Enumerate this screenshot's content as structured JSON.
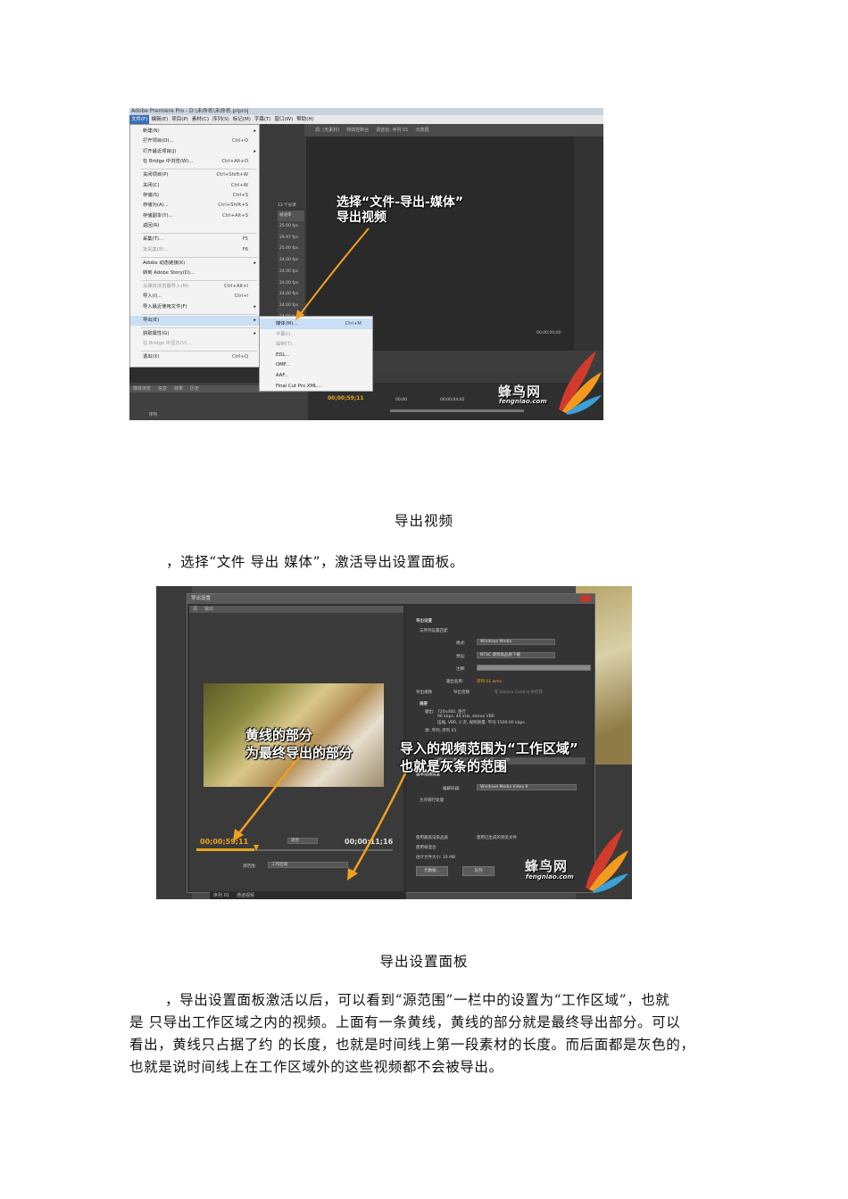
{
  "shot1": {
    "title_bar": "Adobe Premiere Pro - D:\\未命名\\未命名.prproj",
    "menubar": [
      {
        "label": "文件(F)",
        "active": true
      },
      {
        "label": "编辑(E)"
      },
      {
        "label": "项目(P)"
      },
      {
        "label": "素材(C)"
      },
      {
        "label": "序列(S)"
      },
      {
        "label": "标记(M)"
      },
      {
        "label": "字幕(T)"
      },
      {
        "label": "窗口(W)"
      },
      {
        "label": "帮助(H)"
      }
    ],
    "file_menu": [
      {
        "label": "新建(N)",
        "arrow": "▸"
      },
      {
        "label": "打开项目(O)...",
        "key": "Ctrl+O"
      },
      {
        "label": "打开最近项目(J)",
        "arrow": "▸"
      },
      {
        "label": "在 Bridge 中浏览(W)...",
        "key": "Ctrl+Alt+O"
      },
      {
        "label": "关闭项目(P)",
        "key": "Ctrl+Shift+W"
      },
      {
        "label": "关闭(C)",
        "key": "Ctrl+W"
      },
      {
        "label": "存储(S)",
        "key": "Ctrl+S"
      },
      {
        "label": "存储为(A)...",
        "key": "Ctrl+Shift+S"
      },
      {
        "label": "存储副本(Y)...",
        "key": "Ctrl+Alt+S"
      },
      {
        "label": "返回(R)"
      },
      {
        "label": "采集(T)...",
        "key": "F5"
      },
      {
        "label": "批采集(B)...",
        "key": "F6",
        "disabled": true
      },
      {
        "label": "Adobe 动态链接(K)",
        "arrow": "▸"
      },
      {
        "label": "转到 Adobe Story(D)..."
      },
      {
        "label": "从媒体浏览器导入(M)",
        "key": "Ctrl+Alt+I",
        "disabled": true
      },
      {
        "label": "导入(I)...",
        "key": "Ctrl+I"
      },
      {
        "label": "导入最近使用文件(F)",
        "arrow": "▸"
      },
      {
        "label": "导出(E)",
        "arrow": "▸",
        "selected": true
      },
      {
        "label": "获取属性(G)",
        "arrow": "▸"
      },
      {
        "label": "在 Bridge 中显示(V)...",
        "disabled": true
      },
      {
        "label": "退出(X)",
        "key": "Ctrl+Q"
      }
    ],
    "export_submenu": [
      {
        "label": "媒体(M)...",
        "key": "Ctrl+M",
        "selected": true
      },
      {
        "label": "字幕(I)...",
        "disabled": true
      },
      {
        "label": "磁带(T)...",
        "disabled": true
      },
      {
        "label": "EDL..."
      },
      {
        "label": "OMF..."
      },
      {
        "label": "AAF..."
      },
      {
        "label": "Final Cut Pro XML..."
      }
    ],
    "project_count": "13 个分项",
    "frame_rate_header": "帧速率",
    "frame_rates": [
      "25.00 fps",
      "29.97 fps",
      "25.00 fps",
      "24.00 fps",
      "24.00 fps",
      "24.00 fps",
      "24.00 fps",
      "24.00 fps",
      "24.00 fps"
    ],
    "source_tabs": [
      "源: (无素材)",
      "特效控制台",
      "调音台: 序列 01",
      "元数据"
    ],
    "bottom_tabs": [
      "媒体浏览",
      "信息",
      "效果",
      "历史"
    ],
    "project_item": "序列",
    "timecode_program": "00;00;00;00",
    "timecode_seq": "00;00;59;11",
    "ruler_start": "00;00",
    "ruler_mid": "00;00;04;02",
    "callout_lines": [
      "选择“文件-导出-媒体”",
      "导出视频"
    ],
    "logo_text": "蜂鸟网",
    "logo_url": "fengniao.com"
  },
  "caption1": "导出视频",
  "para1": "，选择“文件  导出  媒体”，激活导出设置面板。",
  "shot2": {
    "dialog_title": "导出设置",
    "left_tabs": [
      "源",
      "输出"
    ],
    "section_export": "导出设置",
    "match_seq": "与序列设置匹配",
    "format_label": "格式:",
    "format_value": "Windows Media",
    "preset_label": "预设:",
    "preset_value": "NTSC 源到高品质下载",
    "comment_label": "注释:",
    "output_label": "输出名称:",
    "output_value": "序列 01.wmv",
    "export_video": "导出视频",
    "export_audio": "导出音频",
    "device_central": "在 Device Central 中打开",
    "summary_title": "摘要",
    "summary_output_label": "输出:",
    "summary_lines": [
      "720x480, 逐行",
      "96 kbps, 44 kHz, stereo VBR",
      "压缩, VBR, 2 次, 视频质量: 平均 1500.00 kbps"
    ],
    "summary_source": "源: 序列, 序列 01",
    "tabs_mid": [
      "滤镜",
      "格式",
      "视频",
      "音频",
      "FTP"
    ],
    "video_section": "基本视频设置",
    "codec_label": "编解码器:",
    "codec_value": "Windows Media Video 9",
    "allow_interlace": "允许隔行处理",
    "max_quality": "使用最高渲染品质",
    "use_preview": "使用已生成的预览文件",
    "frame_blend": "使用帧混合",
    "file_size": "估计文件大小: 10 MB",
    "btn_metadata": "元数据...",
    "btn_queue": "队列",
    "tc_in": "00;00;59;11",
    "tc_out": "00;00;11;16",
    "fit_label": "适合",
    "source_range_label": "源范围:",
    "source_range_value": "工作区域",
    "callout_left": [
      "黄线的部分",
      "为最终导出的部分"
    ],
    "callout_right": [
      "导入的视频范围为“工作区域”",
      "也就是灰条的范围"
    ],
    "timeline_tabs": [
      "序列 01",
      "通道视频"
    ],
    "logo_text": "蜂鸟网",
    "logo_url": "fengniao.com"
  },
  "caption2": "导出设置面板",
  "para2_lines": [
    "，导出设置面板激活以后，可以看到“源范围”一栏中的设置为“工作区域”，也就",
    "是      只导出工作区域之内的视频。上面有一条黄线，黄线的部分就是最终导出部分。可以",
    "看出，黄线只占据了约      的长度，也就是时间线上第一段素材的长度。而后面都是灰色的，",
    "也就是说时间线上在工作区域外的这些视频都不会被导出。"
  ],
  "colors": {
    "accent_orange": "#e8a51f",
    "menu_select": "#c9dff5",
    "dark_ui": "#3b3b3b"
  }
}
